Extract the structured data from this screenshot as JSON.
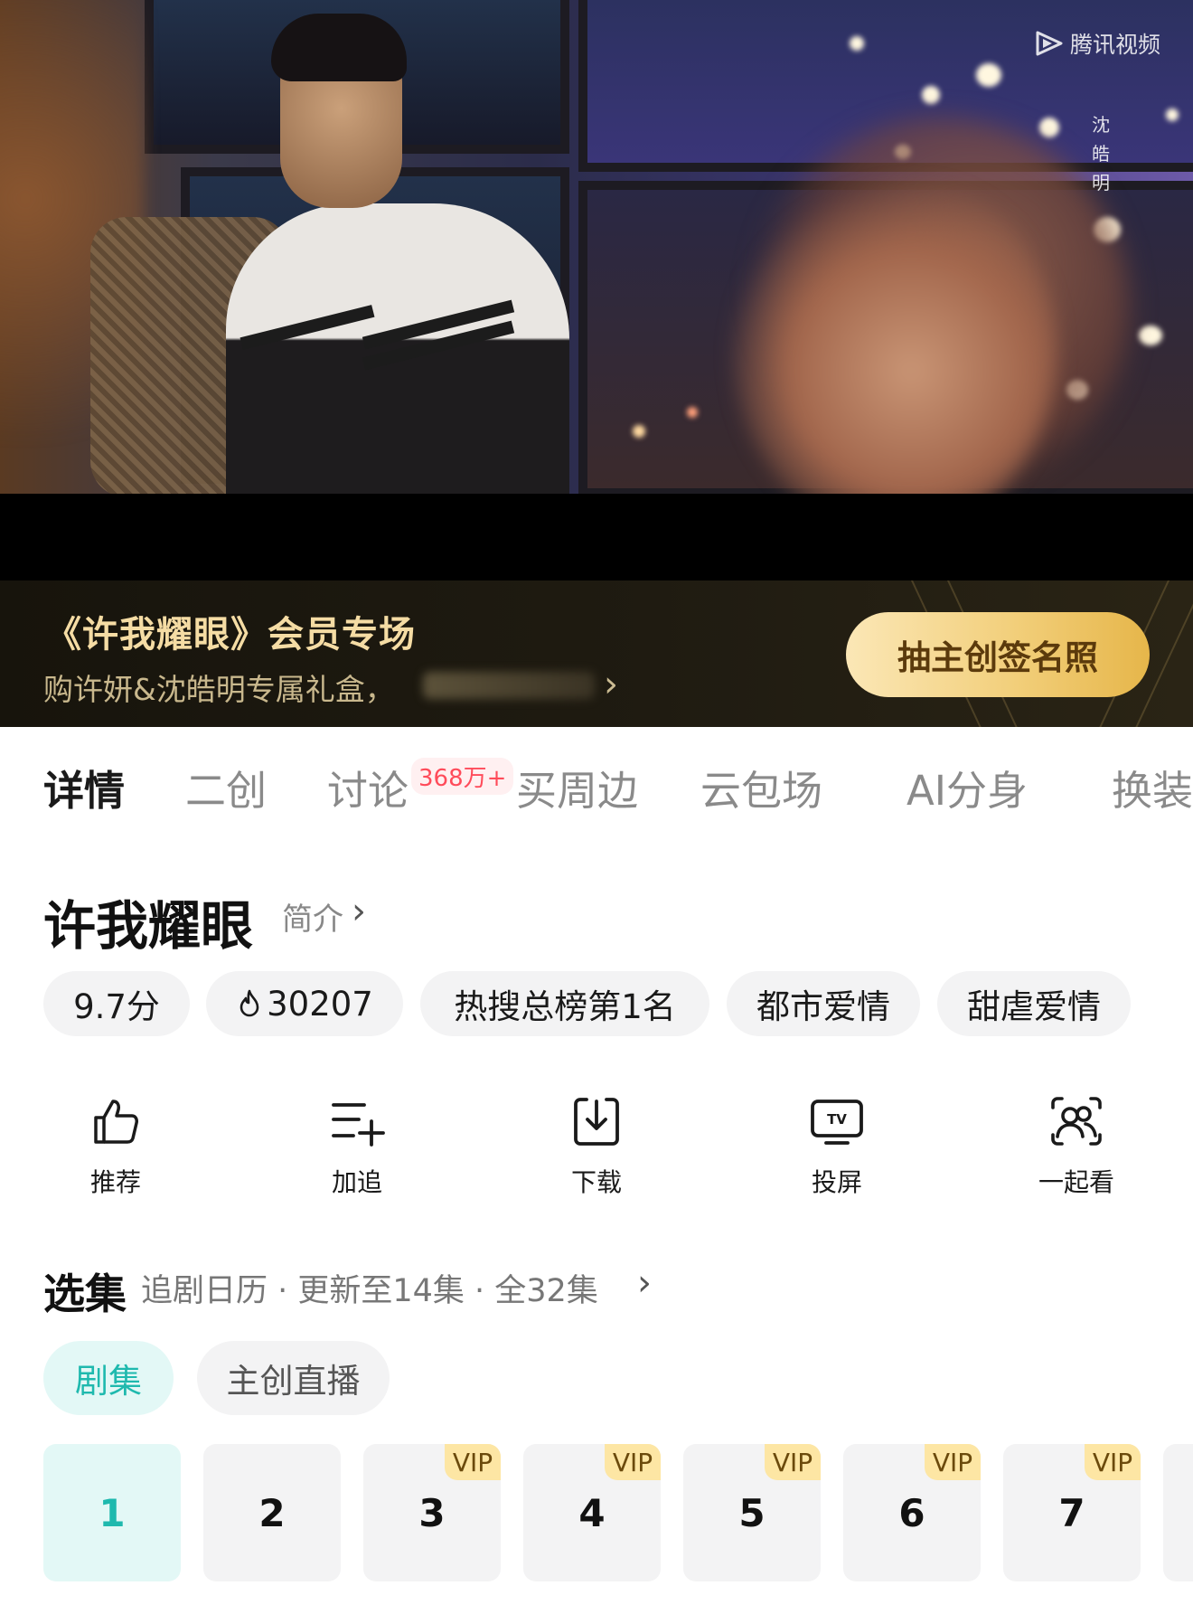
{
  "video": {
    "watermark": "腾讯视频",
    "vertical_caption": "沈皓明"
  },
  "promo": {
    "title": "《许我耀眼》会员专场",
    "subtitle": "购许妍&沈皓明专属礼盒，",
    "button": "抽主创签名照"
  },
  "tabs": [
    {
      "label": "详情",
      "active": true
    },
    {
      "label": "二创",
      "active": false
    },
    {
      "label": "讨论",
      "active": false,
      "badge": "368万+"
    },
    {
      "label": "买周边",
      "active": false
    },
    {
      "label": "云包场",
      "active": false
    },
    {
      "label": "AI分身",
      "active": false
    },
    {
      "label": "换装",
      "active": false
    }
  ],
  "show": {
    "title": "许我耀眼",
    "intro_link": "简介"
  },
  "chips": [
    "9.7分",
    "30207",
    "热搜总榜第1名",
    "都市爱情",
    "甜虐爱情"
  ],
  "actions": [
    {
      "label": "推荐",
      "icon": "thumbs-up-icon"
    },
    {
      "label": "加追",
      "icon": "add-list-icon"
    },
    {
      "label": "下载",
      "icon": "download-icon"
    },
    {
      "label": "投屏",
      "icon": "tv-cast-icon"
    },
    {
      "label": "一起看",
      "icon": "watch-together-icon"
    }
  ],
  "episodes": {
    "heading": "选集",
    "meta": "追剧日历 · 更新至14集 · 全32集",
    "segments": [
      "剧集",
      "主创直播"
    ],
    "items": [
      {
        "num": "1",
        "vip": ""
      },
      {
        "num": "2",
        "vip": ""
      },
      {
        "num": "3",
        "vip": "VIP"
      },
      {
        "num": "4",
        "vip": "VIP"
      },
      {
        "num": "5",
        "vip": "VIP"
      },
      {
        "num": "6",
        "vip": "VIP"
      },
      {
        "num": "7",
        "vip": "VIP"
      }
    ]
  },
  "colors": {
    "accent": "#1fb9ae",
    "promo_gold": "#f2cf7b",
    "badge_red": "#ff4b5a"
  }
}
